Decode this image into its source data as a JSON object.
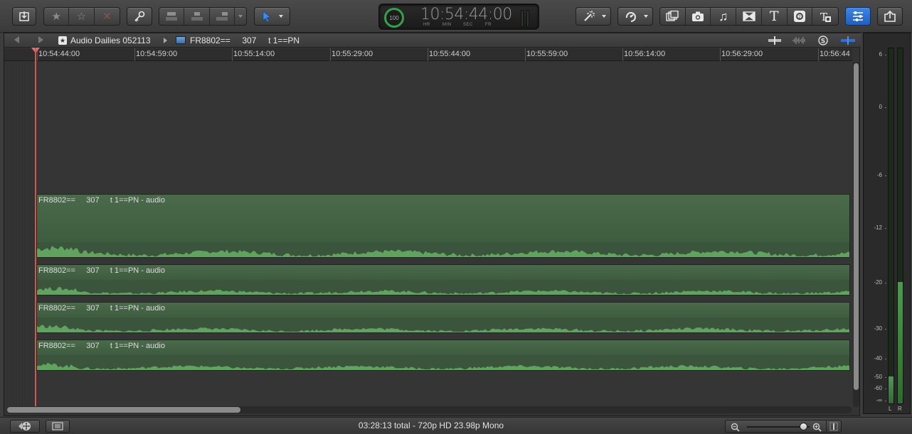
{
  "toolbar": {
    "timecode": {
      "percent": "100",
      "digits": "10:54:44:00",
      "units": [
        "HR",
        "MIN",
        "SEC",
        "FR"
      ]
    },
    "icons": {
      "import": "import-media-icon",
      "favorite": "favorite-star-icon",
      "unrated": "unrated-star-icon",
      "reject": "reject-x-icon",
      "keyword": "keyword-key-icon",
      "connect": "connect-clip-icon",
      "insert": "insert-clip-icon",
      "append": "append-clip-icon",
      "select": "select-arrow-icon",
      "enhance": "magic-wand-icon",
      "retime": "retime-icon",
      "browser_video": "video-effects-icon",
      "photos": "camera-icon",
      "music": "music-note-icon",
      "transitions": "transition-icon",
      "titles": "title-t-icon",
      "generators": "generator-icon",
      "themes": "themes-icon",
      "inspector": "inspector-icon",
      "share": "share-icon"
    }
  },
  "timeline": {
    "breadcrumb": {
      "project": "Audio Dailies 052113",
      "clip": "FR8802==     307     t 1==PN"
    },
    "ruler": {
      "ticks": [
        "10:54:44:00",
        "10:54:59:00",
        "10:55:14:00",
        "10:55:29:00",
        "10:55:44:00",
        "10:55:59:00",
        "10:56:14:00",
        "10:56:29:00",
        "10:56:44"
      ]
    },
    "clips": [
      {
        "title": "FR8802==     307     t 1==PN - audio"
      },
      {
        "title": "FR8802==     307     t 1==PN - audio"
      },
      {
        "title": "FR8802==     307     t 1==PN - audio"
      },
      {
        "title": "FR8802==     307     t 1==PN - audio"
      }
    ]
  },
  "meters": {
    "scale": [
      "6",
      "0",
      "-6",
      "-12",
      "-20",
      "-30",
      "-40",
      "-50",
      "-60",
      "-∞"
    ],
    "channels": [
      "L",
      "R"
    ],
    "levels_db": {
      "L": -50,
      "R": -20
    }
  },
  "status": {
    "summary": "03:28:13 total - 720p HD 23.98p Mono"
  },
  "zoom": {
    "level": 0.9
  },
  "colors": {
    "accent_blue": "#2d6fd8",
    "clip_green": "#3f5d40",
    "playhead": "#d9534f",
    "timecode_ring": "#2fa34a"
  }
}
